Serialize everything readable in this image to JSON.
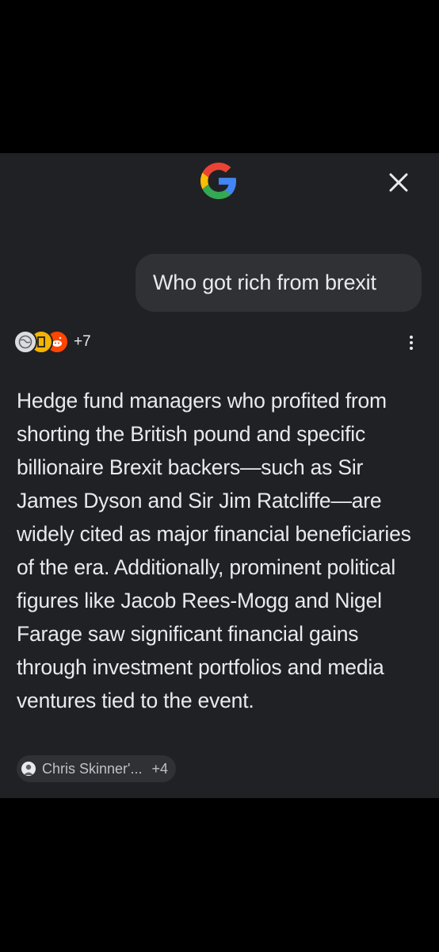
{
  "query": {
    "text": "Who got rich from brexit"
  },
  "sources": {
    "icons": [
      "globe-icon",
      "news-site-icon",
      "reddit-icon"
    ],
    "count_label": "+7"
  },
  "answer": {
    "text": "Hedge fund managers who profited from shorting the British pound and specific billionaire Brexit backers—such as Sir James Dyson and Sir Jim Ratcliffe—are widely cited as major financial beneficiaries of the era. Additionally, prominent political figures like Jacob Rees-Mogg and Nigel Farage saw significant financial gains through investment portfolios and media ventures tied to the event."
  },
  "citation": {
    "label": "Chris Skinner'...",
    "count": "+4"
  },
  "colors": {
    "panel_bg": "#202124",
    "bubble_bg": "#303134",
    "text": "#e8eaed"
  }
}
